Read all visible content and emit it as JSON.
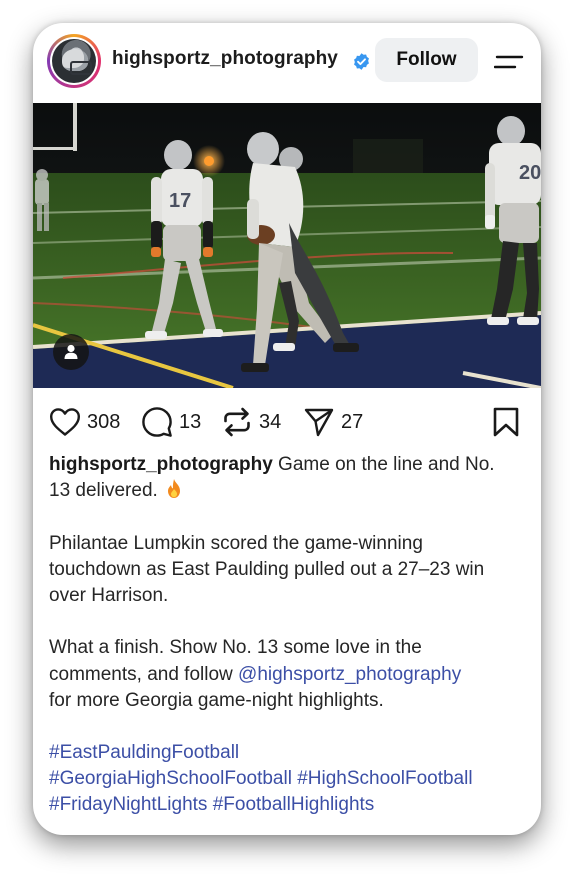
{
  "header": {
    "username": "highsportz_photography",
    "follow_label": "Follow"
  },
  "actions": {
    "likes": "308",
    "comments": "13",
    "reposts": "34",
    "shares": "27"
  },
  "caption": {
    "author": "highsportz_photography",
    "line1_text": " Game on the line and No.",
    "line2_text": "13 delivered.",
    "para2_line1": "Philantae Lumpkin scored the game-winning",
    "para2_line2": "touchdown as East Paulding pulled out a 27–23 win",
    "para2_line3": "over Harrison.",
    "para3_line1": "What a finish. Show No. 13 some love in the",
    "para3_line2_pre": "comments, and follow ",
    "mention": "@highsportz_photography",
    "para3_line3": "for more Georgia game-night highlights.",
    "hashtags": {
      "tag1": "#EastPauldingFootball",
      "tag2": "#GeorgiaHighSchoolFootball",
      "tag3": "#HighSchoolFootball",
      "tag4": "#FridayNightLights",
      "tag5": "#FootballHighlights"
    }
  },
  "colors": {
    "link": "#3c4fa6",
    "verified": "#3897f0",
    "field_turf": "#3f6b22",
    "end_zone": "#1e2a55"
  },
  "icons": [
    "verified-badge-icon",
    "menu-icon",
    "user-tag-icon",
    "heart-icon",
    "comment-icon",
    "repost-icon",
    "share-icon",
    "bookmark-icon",
    "fire-emoji-icon"
  ]
}
